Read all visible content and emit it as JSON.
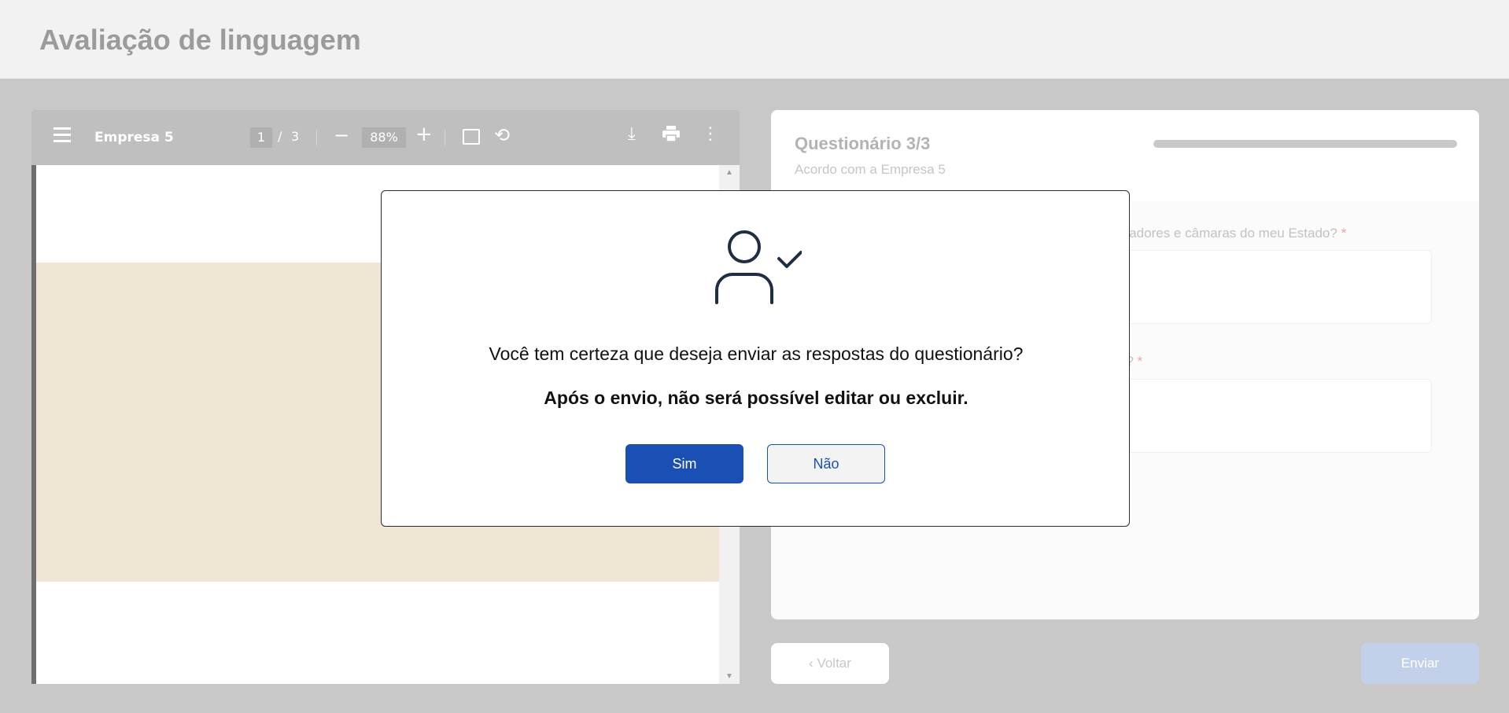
{
  "app": {
    "title": "Avaliação de linguagem"
  },
  "pdf_viewer": {
    "document_name": "Empresa 5",
    "current_page": "1",
    "page_separator": "/",
    "total_pages": "3",
    "zoom": "88%",
    "icons": [
      "menu-icon",
      "zoom-out-icon",
      "zoom-in-icon",
      "fit-page-icon",
      "rotate-icon",
      "download-icon",
      "print-icon",
      "more-options-icon"
    ]
  },
  "questionnaire": {
    "title": "Questionário 3/3",
    "subtitle": "Acordo com a Empresa 5",
    "question_1_visible": "diadores e câmaras do meu Estado?",
    "question_2_visible": "o?",
    "required_mark": "*"
  },
  "navigation": {
    "back_label": "Voltar",
    "back_icon": "‹",
    "send_label": "Enviar"
  },
  "modal": {
    "icon": "user-check-icon",
    "question": "Você tem certeza que deseja enviar as respostas do questionário?",
    "warning": "Após o envio, não será possível editar ou excluir.",
    "yes_label": "Sim",
    "no_label": "Não"
  },
  "colors": {
    "primary": "#1a4fb4",
    "overlay": "#c8c8c8",
    "icon_stroke": "#1f2d45"
  }
}
